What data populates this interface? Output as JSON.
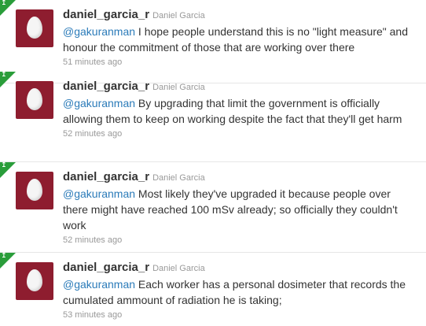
{
  "colors": {
    "retweet_corner": "#2a9d3a",
    "avatar_bg": "#8e1d2f",
    "mention": "#2b7bb9",
    "text": "#333333",
    "meta": "#999999"
  },
  "tweets": [
    {
      "screen_name": "daniel_garcia_r",
      "full_name": "Daniel Garcia",
      "mention": "@gakuranman",
      "body": " I hope people understand this is no \"light measure\" and honour the commitment of those that are working over there",
      "timestamp": "51 minutes ago",
      "corner_icon": "retweet-icon",
      "avatar_icon": "default-egg-avatar"
    },
    {
      "screen_name": "daniel_garcia_r",
      "full_name": "Daniel Garcia",
      "mention": "@gakuranman",
      "body": " By upgrading that limit the government is officially allowing them to keep on working despite the fact that they'll get harm",
      "timestamp": "52 minutes ago",
      "corner_icon": "retweet-icon",
      "avatar_icon": "default-egg-avatar"
    },
    {
      "screen_name": "daniel_garcia_r",
      "full_name": "Daniel Garcia",
      "mention": "@gakuranman",
      "body": " Most likely they've upgraded it because people over there might have reached 100 mSv already; so officially they couldn't work",
      "timestamp": "52 minutes ago",
      "corner_icon": "retweet-icon",
      "avatar_icon": "default-egg-avatar"
    },
    {
      "screen_name": "daniel_garcia_r",
      "full_name": "Daniel Garcia",
      "mention": "@gakuranman",
      "body": " Each worker has a personal dosimeter that records the cumulated ammount of radiation he is taking;",
      "timestamp": "53 minutes ago",
      "corner_icon": "retweet-icon",
      "avatar_icon": "default-egg-avatar"
    }
  ]
}
